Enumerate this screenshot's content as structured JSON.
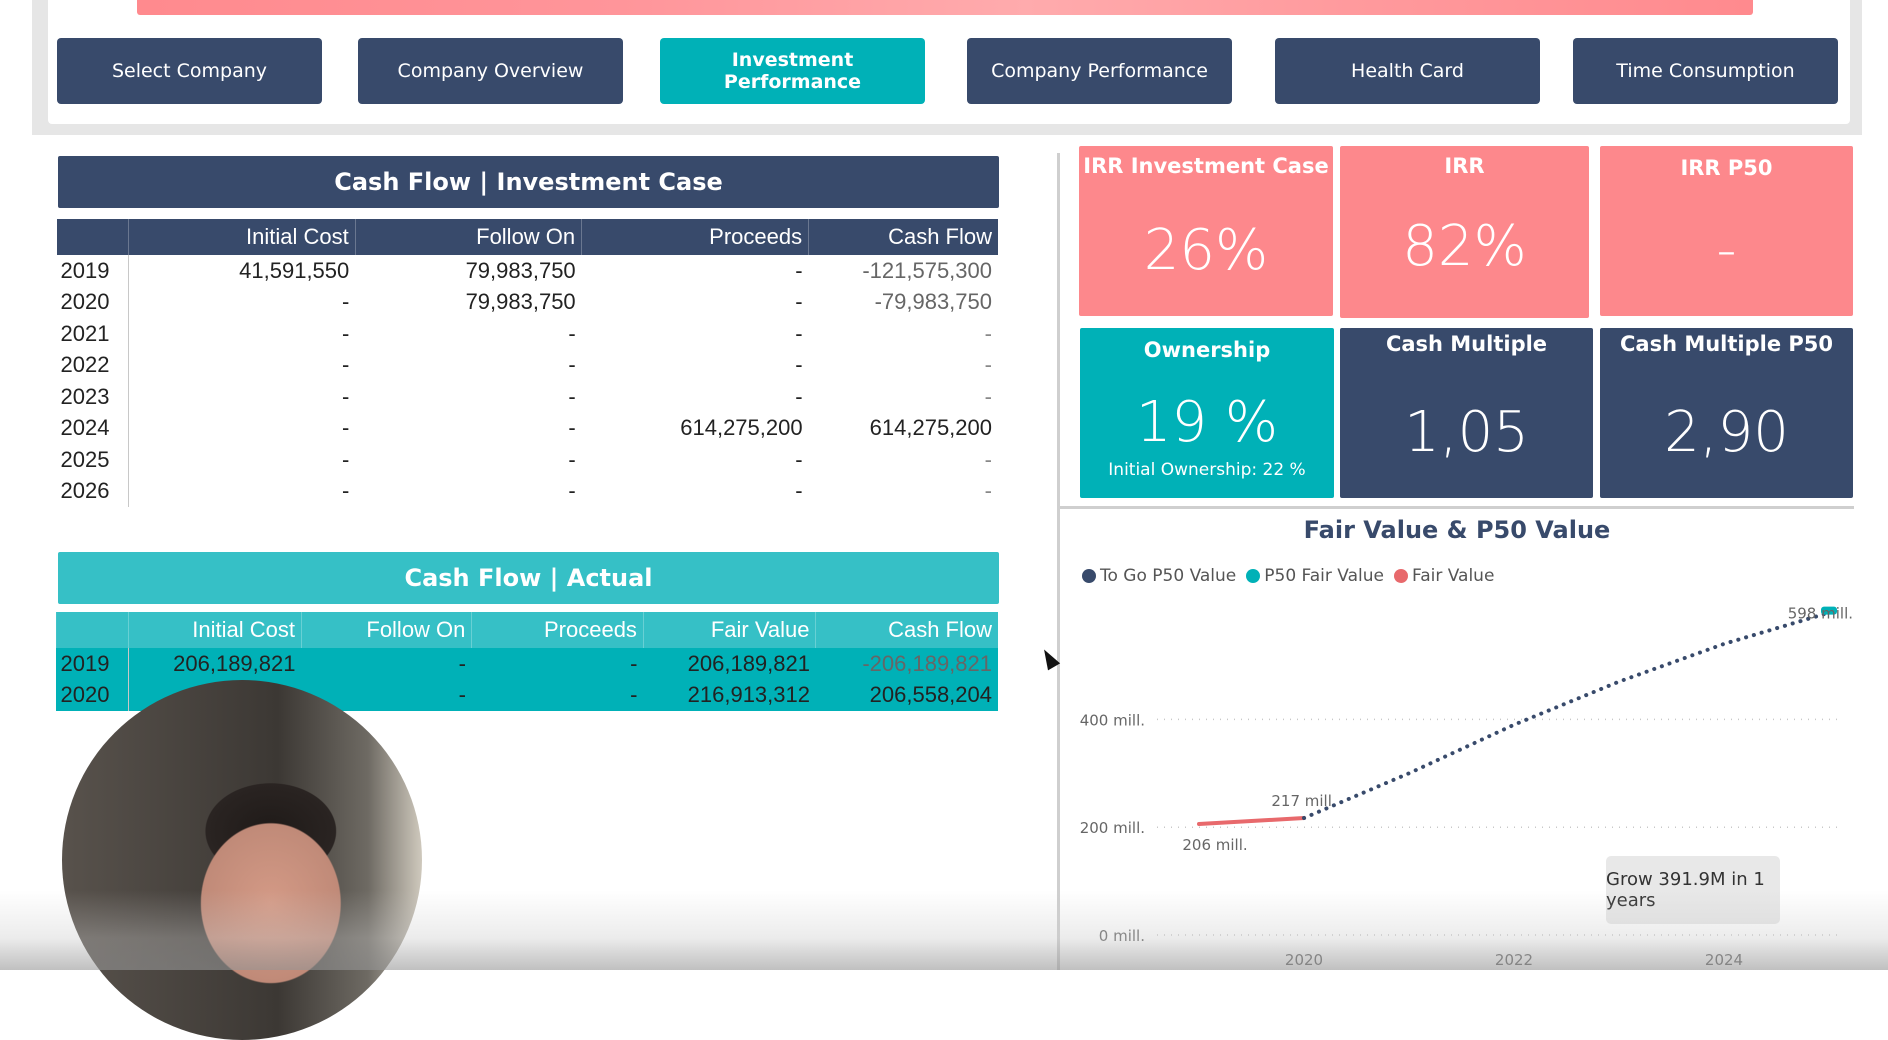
{
  "nav": {
    "buttons": [
      {
        "label": "Select Company",
        "active": false
      },
      {
        "label": "Company Overview",
        "active": false
      },
      {
        "label": "Investment Performance",
        "active": true
      },
      {
        "label": "Company Performance",
        "active": false
      },
      {
        "label": "Health Card",
        "active": false
      },
      {
        "label": "Time Consumption",
        "active": false
      }
    ]
  },
  "investment_case": {
    "title": "Cash Flow | Investment Case",
    "columns": [
      "",
      "Initial Cost",
      "Follow On",
      "Proceeds",
      "Cash Flow"
    ],
    "rows": [
      [
        "2019",
        "41,591,550",
        "79,983,750",
        "-",
        "-121,575,300"
      ],
      [
        "2020",
        "-",
        "79,983,750",
        "-",
        "-79,983,750"
      ],
      [
        "2021",
        "-",
        "-",
        "-",
        "-"
      ],
      [
        "2022",
        "-",
        "-",
        "-",
        "-"
      ],
      [
        "2023",
        "-",
        "-",
        "-",
        "-"
      ],
      [
        "2024",
        "-",
        "-",
        "614,275,200",
        "614,275,200"
      ],
      [
        "2025",
        "-",
        "-",
        "-",
        "-"
      ],
      [
        "2026",
        "-",
        "-",
        "-",
        "-"
      ]
    ]
  },
  "actual": {
    "title": "Cash Flow | Actual",
    "columns": [
      "",
      "Initial Cost",
      "Follow On",
      "Proceeds",
      "Fair Value",
      "Cash Flow"
    ],
    "rows": [
      [
        "2019",
        "206,189,821",
        "-",
        "-",
        "206,189,821",
        "-206,189,821"
      ],
      [
        "2020",
        "",
        "-",
        "-",
        "216,913,312",
        "206,558,204"
      ]
    ]
  },
  "kpis": {
    "irr_investment_case": {
      "title": "IRR Investment Case",
      "value": "26%"
    },
    "irr": {
      "title": "IRR",
      "value": "82%"
    },
    "irr_p50": {
      "title": "IRR P50",
      "value": "-"
    },
    "ownership": {
      "title": "Ownership",
      "value": "19 %",
      "subtitle": "Initial Ownership: 22 %"
    },
    "cash_multiple": {
      "title": "Cash Multiple",
      "value": "1,05"
    },
    "cash_multiple_p50": {
      "title": "Cash Multiple P50",
      "value": "2,90"
    }
  },
  "colors": {
    "navy": "#384a6b",
    "teal": "#00b1b7",
    "pink": "#fd888c",
    "fair_value_line": "#e8696c"
  },
  "chart_data": {
    "type": "line",
    "title": "Fair Value & P50 Value",
    "legend": [
      "To Go P50 Value",
      "P50 Fair Value",
      "Fair Value"
    ],
    "legend_position": "top-left",
    "x_ticks": [
      "2020",
      "2022",
      "2024"
    ],
    "y_ticks": [
      "0 mill.",
      "200 mill.",
      "400 mill."
    ],
    "ylim": [
      0,
      640
    ],
    "xlim": [
      2018.6,
      2025.2
    ],
    "grid": true,
    "series": [
      {
        "name": "Fair Value",
        "x": [
          2019,
          2020
        ],
        "y": [
          206,
          217
        ],
        "labels": [
          "206 mill.",
          "217 mill."
        ]
      },
      {
        "name": "To Go P50 Value",
        "x": [
          2020,
          2021,
          2022,
          2023,
          2024,
          2025
        ],
        "y": [
          217,
          300,
          390,
          470,
          540,
          598
        ],
        "style": "dotted"
      },
      {
        "name": "P50 Fair Value",
        "x": [
          2025
        ],
        "y": [
          598
        ],
        "labels": [
          "598 mill."
        ]
      }
    ],
    "annotation": "Grow 391.9M in 1 years"
  }
}
